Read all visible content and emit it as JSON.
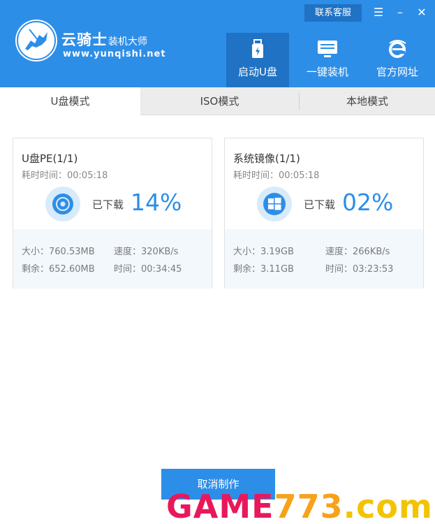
{
  "header": {
    "brand_name": "云骑士",
    "brand_sub": "装机大师",
    "brand_url": "www.yunqishi.net",
    "support_label": "联系客服",
    "menu_glyph": "☰",
    "minimize_glyph": "–",
    "close_glyph": "✕",
    "nav": [
      {
        "label": "启动U盘",
        "icon": "usb-drive-icon",
        "active": true
      },
      {
        "label": "一键装机",
        "icon": "monitor-icon",
        "active": false
      },
      {
        "label": "官方网址",
        "icon": "ie-browser-icon",
        "active": false
      }
    ]
  },
  "tabs": [
    {
      "label": "U盘模式",
      "active": true
    },
    {
      "label": "ISO模式",
      "active": false
    },
    {
      "label": "本地模式",
      "active": false
    }
  ],
  "downloads": [
    {
      "title": "U盘PE(1/1)",
      "elapsed": "耗时时间：00:05:18",
      "icon": "disc-icon",
      "status": "已下载",
      "percent": "14%",
      "size": "大小：760.53MB",
      "speed": "速度：320KB/s",
      "remaining": "剩余：652.60MB",
      "time": "时间：00:34:45"
    },
    {
      "title": "系统镜像(1/1)",
      "elapsed": "耗时时间：00:05:18",
      "icon": "windows-icon",
      "status": "已下载",
      "percent": "02%",
      "size": "大小：3.19GB",
      "speed": "速度：266KB/s",
      "remaining": "剩余：3.11GB",
      "time": "时间：03:23:53"
    }
  ],
  "cancel_label": "取消制作",
  "watermark": {
    "part1": "GAME",
    "part2": "773",
    "part3": ".com"
  },
  "colors": {
    "accent": "#2d8ee8",
    "accent_dark": "#1f72c4",
    "watermark_pink": "#e8185b",
    "watermark_orange": "#f6a21a"
  }
}
